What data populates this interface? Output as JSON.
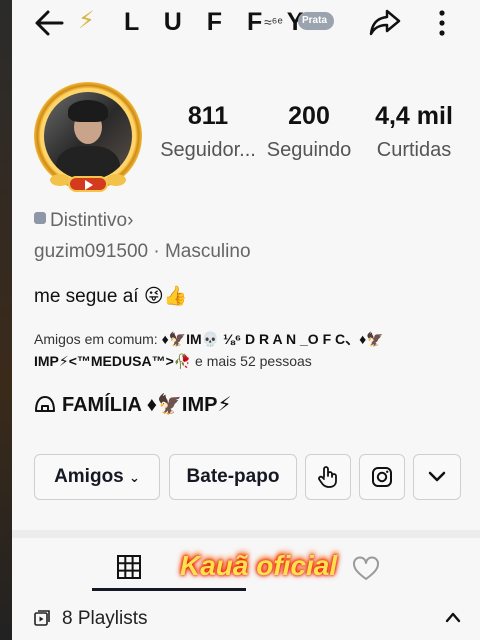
{
  "header": {
    "title": "L U F F Y",
    "bolt_icon": "lightning-icon",
    "signal": "≈⁶ᵉ",
    "rank_badge": "Prata"
  },
  "profile": {
    "stats": [
      {
        "value": "811",
        "label": "Seguidor..."
      },
      {
        "value": "200",
        "label": "Seguindo"
      },
      {
        "value": "4,4 mil",
        "label": "Curtidas"
      }
    ],
    "distintivo": "Distintivo",
    "distintivo_arrow": "›",
    "username_line": "guzim091500 · Masculino",
    "bio": "me segue aí 😜👍",
    "mutual_prefix": "Amigos em comum: ",
    "mutual_names_1": "♦🦅IM💀 ⅛⁶ D R A N _O F C、♦🦅",
    "mutual_names_2": "IMP⚡<™MEDUSA™>🥀",
    "mutual_suffix": " e mais 52 pessoas",
    "family_label": "FAMÍLIA ♦🦅IMP⚡"
  },
  "buttons": {
    "friends": "Amigos",
    "chat": "Bate-papo"
  },
  "tabs": {
    "overlay_text": "Kauã oficial"
  },
  "playlists": {
    "label": "8 Playlists"
  },
  "colors": {
    "accent": "#161823",
    "rank_badge": "#9aa3ae",
    "watermark": "#ffe14d"
  }
}
